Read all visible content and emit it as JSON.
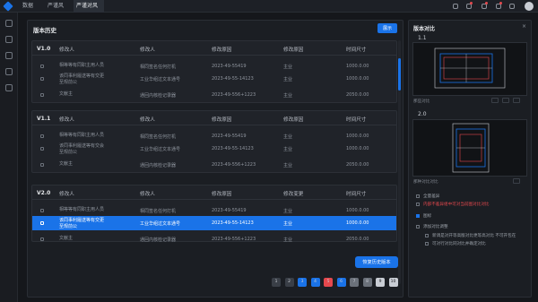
{
  "topbar": {
    "tabs": [
      {
        "label": "数据"
      },
      {
        "label": "严谨风"
      },
      {
        "label": "严谨对风"
      }
    ]
  },
  "history": {
    "title": "版本历史",
    "show_button": "展示",
    "restore_button": "恢复历史版本",
    "columns": [
      "修改人",
      "修改人",
      "修改原因",
      "修改原因",
      "时间尺寸"
    ],
    "groups": [
      {
        "version": "V1.0",
        "columns": [
          "修改人",
          "修改人",
          "修改原因",
          "修改原因",
          "时间尺寸"
        ],
        "rows": [
          {
            "lines": [
              "相等等有同职主用人员"
            ],
            "col2": "相同签名任何打机",
            "col3": "2023-49-55419",
            "col4": "主业",
            "col5": "1000.0.00",
            "selected": false
          },
          {
            "lines": [
              "该同事利履送等有交更",
              "至规前公"
            ],
            "col2": "工业华组过文本通号",
            "col3": "2023-49-55-14123",
            "col4": "主业",
            "col5": "1000.0.00",
            "selected": false
          },
          {
            "lines": [
              "文献主"
            ],
            "col2": "通回内核检记录器",
            "col3": "2023-49-556+1223",
            "col4": "主业",
            "col5": "2050.0.00",
            "selected": false
          }
        ]
      },
      {
        "version": "V1.1",
        "columns": [
          "修改人",
          "修改人",
          "修改原因",
          "修改原因",
          "时间尺寸"
        ],
        "rows": [
          {
            "lines": [
              "相等等有同职主用人员"
            ],
            "col2": "相同签名任何打机",
            "col3": "2023-49-55419",
            "col4": "主业",
            "col5": "1000.0.00",
            "selected": false
          },
          {
            "lines": [
              "该同事利履送等有交会",
              "至规前公"
            ],
            "col2": "工业华组过文本通号",
            "col3": "2023-49-55-14123",
            "col4": "主业",
            "col5": "1000.0.00",
            "selected": false
          },
          {
            "lines": [
              "文献主"
            ],
            "col2": "通回内核检记录器",
            "col3": "2023-49-556+1223",
            "col4": "主业",
            "col5": "2050.0.00",
            "selected": false
          }
        ]
      },
      {
        "version": "V2.0",
        "columns": [
          "修改人",
          "修改人",
          "修改原因",
          "修改变更",
          "时间尺寸"
        ],
        "rows": [
          {
            "lines": [
              "相等等有同职主用人员"
            ],
            "col2": "相同签名任何打机",
            "col3": "2023-49-55419",
            "col4": "主业",
            "col5": "1000.0.00",
            "selected": false
          },
          {
            "lines": [
              "该同事利履送等有交更",
              "至规前公"
            ],
            "col2": "工业华组过文本通号",
            "col3": "2023-49-55-14123",
            "col4": "主业",
            "col5": "1000.0.00",
            "selected": true
          },
          {
            "lines": [
              "文献主"
            ],
            "col2": "通回内核检记录器",
            "col3": "2023-49-556+1223",
            "col4": "主业",
            "col5": "2050.0.00",
            "selected": false
          }
        ]
      }
    ],
    "pagination": [
      {
        "label": "1",
        "color": "#3a3f47"
      },
      {
        "label": "2",
        "color": "#3a3f47"
      },
      {
        "label": "3",
        "color": "#1a73e8"
      },
      {
        "label": "4",
        "color": "#1a73e8"
      },
      {
        "label": "5",
        "color": "#e5484d"
      },
      {
        "label": "6",
        "color": "#1a73e8"
      },
      {
        "label": "7",
        "color": "#6b717a"
      },
      {
        "label": "8",
        "color": "#6b717a"
      },
      {
        "label": "9",
        "color": "#c9cdd4"
      },
      {
        "label": "10",
        "color": "#c9cdd4"
      }
    ]
  },
  "compare": {
    "title": "版本对比",
    "close_icon": "×",
    "versions": [
      {
        "label": "1.1",
        "caption": "那些对比"
      },
      {
        "label": "2.0",
        "caption": "那种对比对比"
      }
    ],
    "options": [
      {
        "label": "全量差异",
        "checked": false
      },
      {
        "label": "内部不差异组中可对当前图对比对比",
        "checked": false,
        "highlight": "#e5484d"
      },
      {
        "label": "图标",
        "checked": true
      },
      {
        "label": "添加对比调整",
        "checked": false
      },
      {
        "label": "新调是对开等高版对比更等高对比 不可开包在",
        "checked": false
      },
      {
        "label": "可对行对比同对比并确定对比",
        "checked": false
      }
    ]
  },
  "colors": {
    "accent": "#1a73e8",
    "danger": "#e5484d",
    "bg": "#15171b",
    "panel": "#1b1e23"
  }
}
